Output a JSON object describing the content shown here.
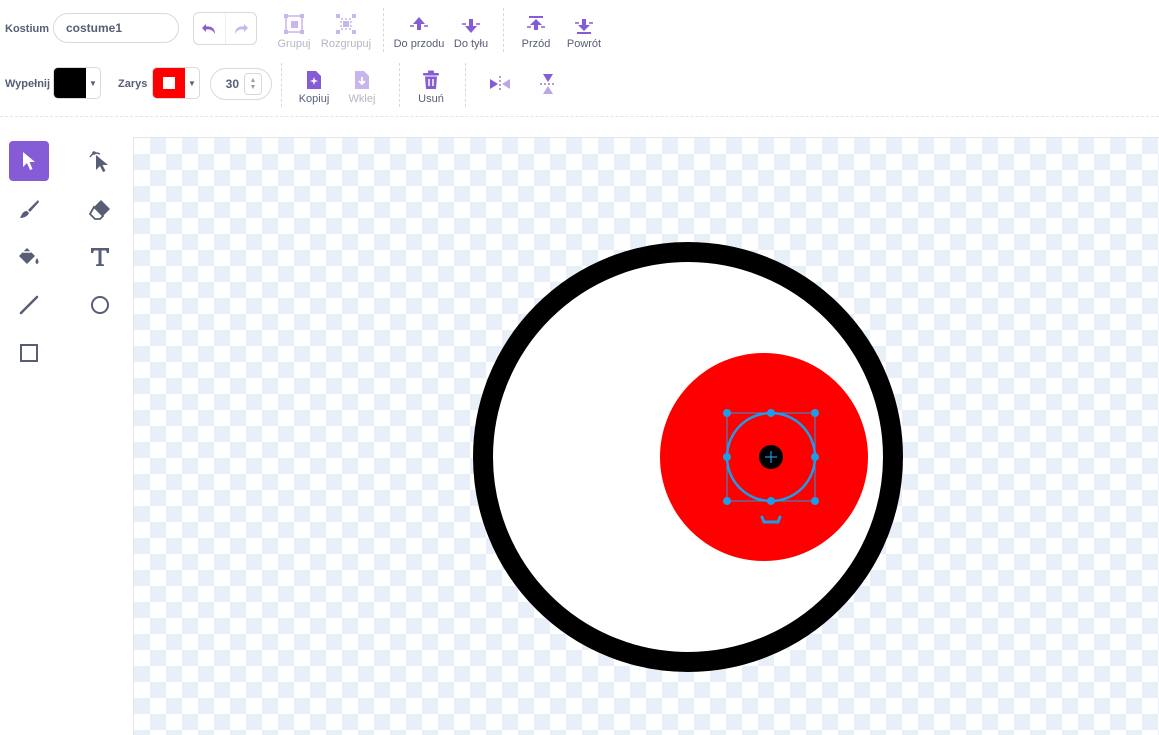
{
  "costume": {
    "label": "Kostium",
    "name": "costume1"
  },
  "toolbar_top": {
    "group": "Grupuj",
    "ungroup": "Rozgrupuj",
    "forward": "Do przodu",
    "backward": "Do tyłu",
    "front": "Przód",
    "back": "Powrót"
  },
  "toolbar_bottom": {
    "fill_label": "Wypełnij",
    "outline_label": "Zarys",
    "outline_width": "30",
    "copy": "Kopiuj",
    "paste": "Wklej",
    "delete": "Usuń"
  },
  "colors": {
    "accent": "#855cd6",
    "fill": "#000000",
    "outline": "#ff0000",
    "selection": "#1e9be9",
    "text": "#575e75"
  },
  "tools": [
    "select-tool",
    "reshape-tool",
    "brush-tool",
    "eraser-tool",
    "fill-tool",
    "text-tool",
    "line-tool",
    "circle-tool",
    "rectangle-tool"
  ],
  "active_tool": "select-tool"
}
